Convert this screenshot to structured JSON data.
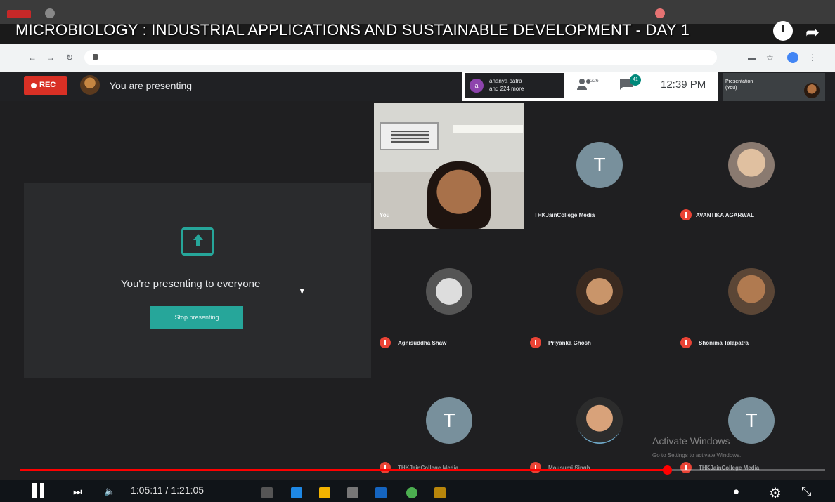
{
  "video_title": "MICROBIOLOGY : INDUSTRIAL APPLICATIONS AND SUSTAINABLE DEVELOPMENT - DAY 1",
  "meet": {
    "rec_label": "REC",
    "presenting_label": "You are presenting",
    "participants_chip": "ananya patra\nand 224 more",
    "participants_initial": "a",
    "people_count": "226",
    "chat_badge": "41",
    "clock": "12:39 PM",
    "self_tile_label": "Presentation\n(You)"
  },
  "presenting": {
    "message": "You're presenting to everyone",
    "stop_button": "Stop presenting"
  },
  "grid": {
    "self_label": "You",
    "tiles": [
      {
        "initial": "T",
        "name": "THKJainCollege Media",
        "mic_off": false
      },
      {
        "initial": "",
        "name": "AVANTIKA AGARWAL",
        "mic_off": true
      },
      {
        "initial": "",
        "name": "Agnisuddha Shaw",
        "mic_off": true
      },
      {
        "initial": "",
        "name": "Priyanka Ghosh",
        "mic_off": true
      },
      {
        "initial": "",
        "name": "Shonima Talapatra",
        "mic_off": true
      },
      {
        "initial": "T",
        "name": "THKJainCollege Media",
        "mic_off": true
      },
      {
        "initial": "",
        "name": "Mousumi Singh",
        "mic_off": true
      },
      {
        "initial": "T",
        "name": "THKJainCollege Media",
        "mic_off": true
      }
    ]
  },
  "player": {
    "time": "1:05:11 / 1:21:05",
    "progress": 0.804
  },
  "windows_watermark": {
    "title": "Activate Windows",
    "subtitle": "Go to Settings to activate Windows."
  },
  "colors": {
    "accent": "#26a69a",
    "rec": "#d93025",
    "progress": "#ff0000"
  }
}
